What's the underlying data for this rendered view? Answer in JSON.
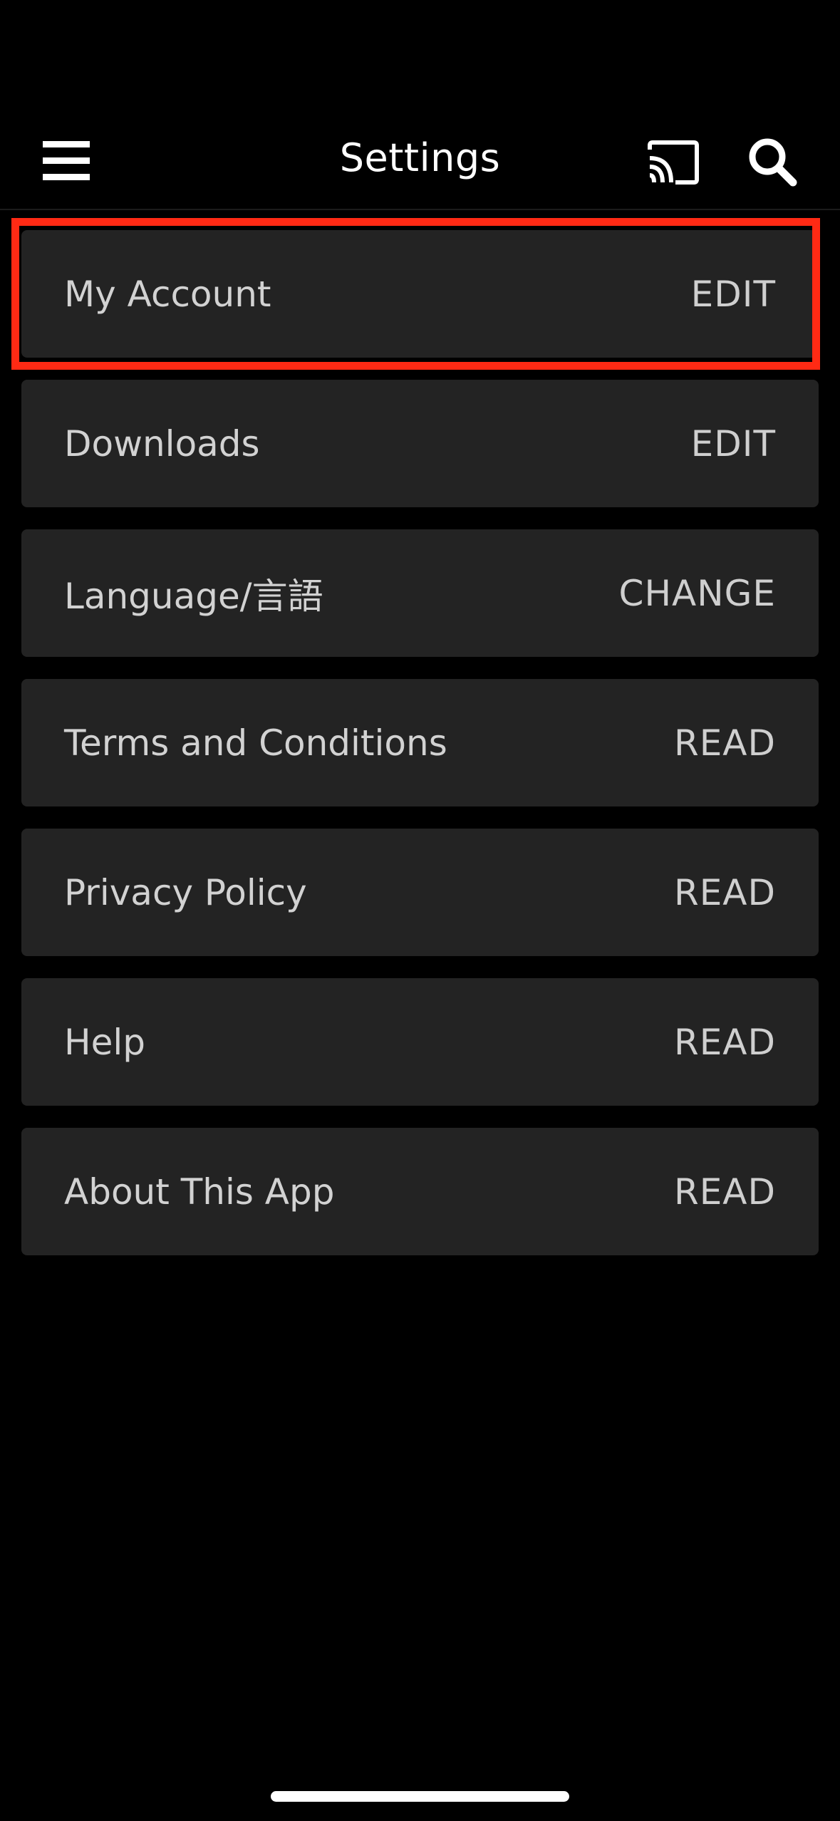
{
  "header": {
    "title": "Settings",
    "menu_icon": "hamburger-menu-icon",
    "cast_icon": "cast-icon",
    "search_icon": "search-icon"
  },
  "rows": [
    {
      "label": "My Account",
      "action": "EDIT"
    },
    {
      "label": "Downloads",
      "action": "EDIT"
    },
    {
      "label": "Language/言語",
      "action": "CHANGE"
    },
    {
      "label": "Terms and Conditions",
      "action": "READ"
    },
    {
      "label": "Privacy Policy",
      "action": "READ"
    },
    {
      "label": "Help",
      "action": "READ"
    },
    {
      "label": "About This App",
      "action": "READ"
    }
  ],
  "colors": {
    "background": "#000000",
    "row_background": "#232323",
    "highlight": "#ff2a14",
    "text": "#d2d2d2"
  }
}
